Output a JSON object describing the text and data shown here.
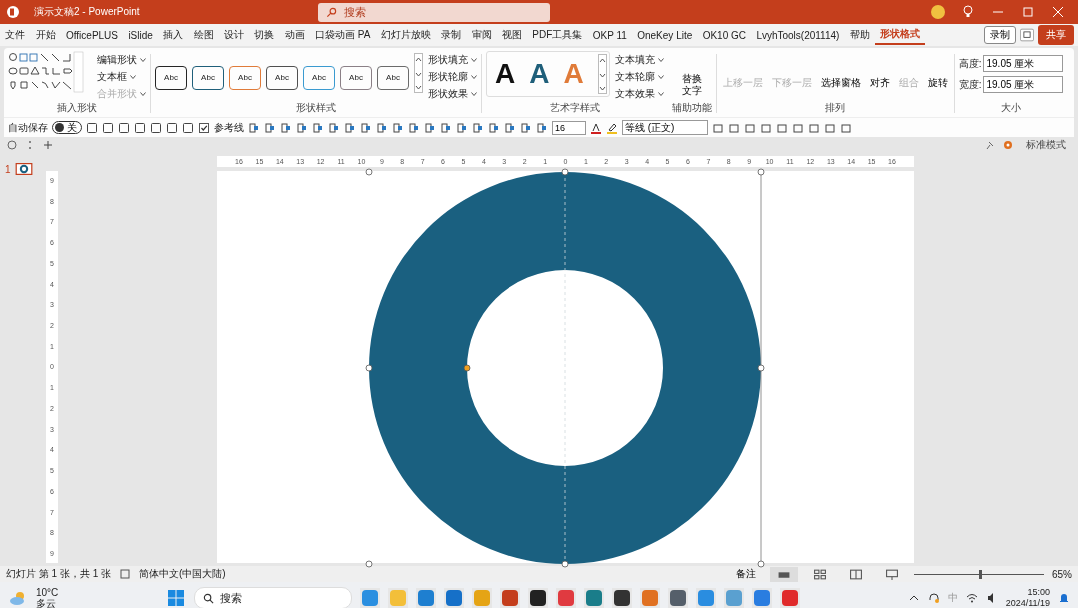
{
  "window": {
    "title": "演示文稿2 - PowerPoint",
    "search_placeholder": "搜索"
  },
  "tabs": [
    {
      "label": "文件",
      "selected": false
    },
    {
      "label": "开始",
      "selected": false
    },
    {
      "label": "OfficePLUS",
      "selected": false
    },
    {
      "label": "iSlide",
      "selected": false
    },
    {
      "label": "插入",
      "selected": false
    },
    {
      "label": "绘图",
      "selected": false
    },
    {
      "label": "设计",
      "selected": false
    },
    {
      "label": "切换",
      "selected": false
    },
    {
      "label": "动画",
      "selected": false
    },
    {
      "label": "口袋动画 PA",
      "selected": false
    },
    {
      "label": "幻灯片放映",
      "selected": false
    },
    {
      "label": "录制",
      "selected": false
    },
    {
      "label": "审阅",
      "selected": false
    },
    {
      "label": "视图",
      "selected": false
    },
    {
      "label": "PDF工具集",
      "selected": false
    },
    {
      "label": "OKP 11",
      "selected": false
    },
    {
      "label": "OneKey Lite",
      "selected": false
    },
    {
      "label": "OK10 GC",
      "selected": false
    },
    {
      "label": "LvyhTools(201114)",
      "selected": false
    },
    {
      "label": "帮助",
      "selected": false
    },
    {
      "label": "形状格式",
      "selected": true
    }
  ],
  "record_button": "录制",
  "share_button": "共享",
  "insert_shapes": {
    "label": "插入形状",
    "commands": [
      {
        "label": "编辑形状",
        "disabled": false
      },
      {
        "label": "文本框",
        "disabled": false
      },
      {
        "label": "合并形状",
        "disabled": true
      }
    ]
  },
  "shape_styles": {
    "label": "形状样式",
    "presets": [
      {
        "label": "Abc",
        "color": "#262626"
      },
      {
        "label": "Abc",
        "color": "#1f5f7a"
      },
      {
        "label": "Abc",
        "color": "#e07b39"
      },
      {
        "label": "Abc",
        "color": "#505050"
      },
      {
        "label": "Abc",
        "color": "#3a9ad0"
      },
      {
        "label": "Abc",
        "color": "#8a7f86"
      },
      {
        "label": "Abc",
        "color": "#6b6b6b"
      }
    ],
    "commands": [
      "形状填充",
      "形状轮廓",
      "形状效果"
    ]
  },
  "wordart_styles": {
    "label": "艺术字样式",
    "presets": [
      {
        "label": "A",
        "color": "#111111"
      },
      {
        "label": "A",
        "color": "#1f5f7a"
      },
      {
        "label": "A",
        "color": "#e07b39"
      }
    ],
    "commands": [
      "文本填充",
      "文本轮廓",
      "文本效果"
    ]
  },
  "accessibility": {
    "label": "辅助功能",
    "commands": [
      "替换文字"
    ]
  },
  "arrange": {
    "label": "排列",
    "commands": [
      {
        "label": "上移一层",
        "disabled": true
      },
      {
        "label": "下移一层",
        "disabled": true
      },
      {
        "label": "选择窗格",
        "disabled": false
      },
      {
        "label": "对齐",
        "disabled": false
      },
      {
        "label": "组合",
        "disabled": true
      },
      {
        "label": "旋转",
        "disabled": false
      }
    ]
  },
  "size": {
    "label": "大小",
    "height_label": "高度:",
    "height": "19.05 厘米",
    "width_label": "宽度:",
    "width": "19.05 厘米"
  },
  "quick_access": {
    "autosave_label": "自动保存",
    "autosave": {
      "on": false,
      "label": "关"
    },
    "guides": {
      "label": "参考线",
      "checked": true
    },
    "font_size": "16",
    "font": "等线 (正文)"
  },
  "view_mode": "标准模式",
  "slides": [
    {
      "number": "1",
      "selected": true
    }
  ],
  "rulers": {
    "horizontal": [
      "16",
      "15",
      "14",
      "13",
      "12",
      "11",
      "10",
      "9",
      "8",
      "7",
      "6",
      "5",
      "4",
      "3",
      "2",
      "1",
      "0",
      "1",
      "2",
      "3",
      "4",
      "5",
      "6",
      "7",
      "8",
      "9",
      "10",
      "11",
      "12",
      "13",
      "14",
      "15",
      "16"
    ],
    "vertical": [
      "9",
      "8",
      "7",
      "6",
      "5",
      "4",
      "3",
      "2",
      "1",
      "0",
      "1",
      "2",
      "3",
      "4",
      "5",
      "6",
      "7",
      "8",
      "9"
    ]
  },
  "shape": {
    "kind": "donut",
    "color": "#1a6080"
  },
  "status_bar": {
    "slide": "幻灯片 第 1 张，共 1 张",
    "language": "简体中文(中国大陆)",
    "notes": "备注",
    "zoom": "65%",
    "zoom_slider": {
      "level": 0.5
    }
  },
  "taskbar": {
    "temperature": "10°C",
    "weather": "多云",
    "search": "搜索",
    "ime": "中",
    "time": "15:00",
    "date": "2024/11/19"
  }
}
